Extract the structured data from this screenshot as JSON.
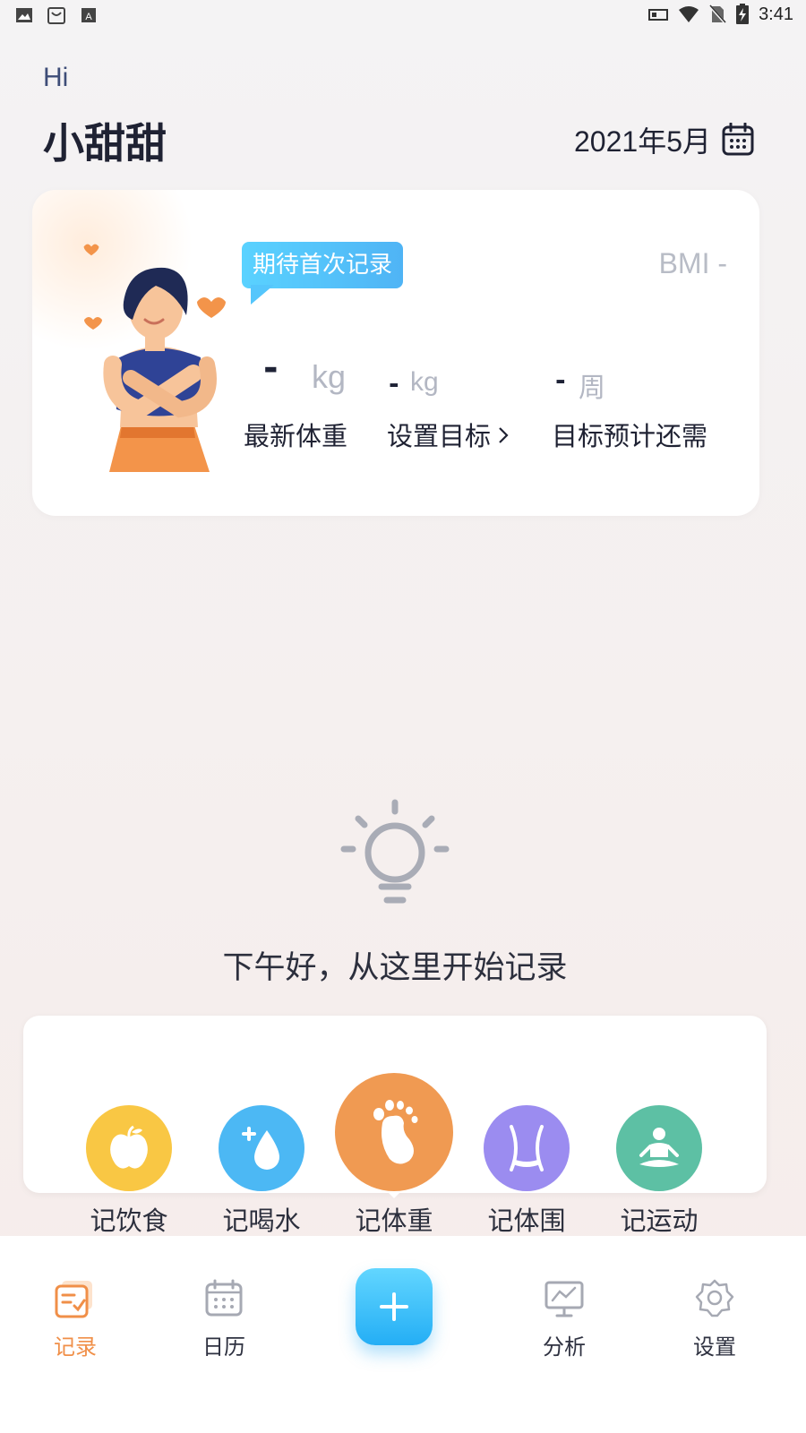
{
  "status_bar": {
    "time": "3:41",
    "icons": [
      "image-icon",
      "shop-icon",
      "font-icon",
      "cast-icon",
      "wifi-icon",
      "no-sim-icon",
      "battery-charging-icon"
    ]
  },
  "header": {
    "greeting": "Hi",
    "username": "小甜甜",
    "date": "2021年5月",
    "date_icon": "calendar-icon"
  },
  "summary_card": {
    "bubble_text": "期待首次记录",
    "bmi": "BMI -",
    "latest_weight": {
      "value": "-",
      "unit": "kg",
      "label": "最新体重"
    },
    "target_weight": {
      "value": "-",
      "unit": "kg",
      "label": "设置目标"
    },
    "weeks_needed": {
      "value": "-",
      "unit": "周",
      "label": "目标预计还需"
    }
  },
  "empty_state": {
    "icon": "lightbulb-icon",
    "message": "下午好，从这里开始记录"
  },
  "quick_actions": [
    {
      "label": "记饮食",
      "icon": "apple-icon",
      "color": "#f9c744"
    },
    {
      "label": "记喝水",
      "icon": "water-drop-icon",
      "color": "#4cb8f4"
    },
    {
      "label": "记体重",
      "icon": "footprint-icon",
      "color": "#f09a52"
    },
    {
      "label": "记体围",
      "icon": "waist-icon",
      "color": "#9b8cf0"
    },
    {
      "label": "记运动",
      "icon": "meditation-icon",
      "color": "#5dc0a4"
    }
  ],
  "bottom_nav": [
    {
      "label": "记录",
      "icon": "record-icon",
      "active": true
    },
    {
      "label": "日历",
      "icon": "calendar-icon",
      "active": false
    },
    {
      "label": "",
      "icon": "plus-icon",
      "active": false
    },
    {
      "label": "分析",
      "icon": "analysis-icon",
      "active": false
    },
    {
      "label": "设置",
      "icon": "settings-icon",
      "active": false
    }
  ],
  "colors": {
    "accent_orange": "#f08f48",
    "accent_blue": "#3fb5f5",
    "text_dark": "#1f2233",
    "text_muted": "#b3b7c3"
  }
}
